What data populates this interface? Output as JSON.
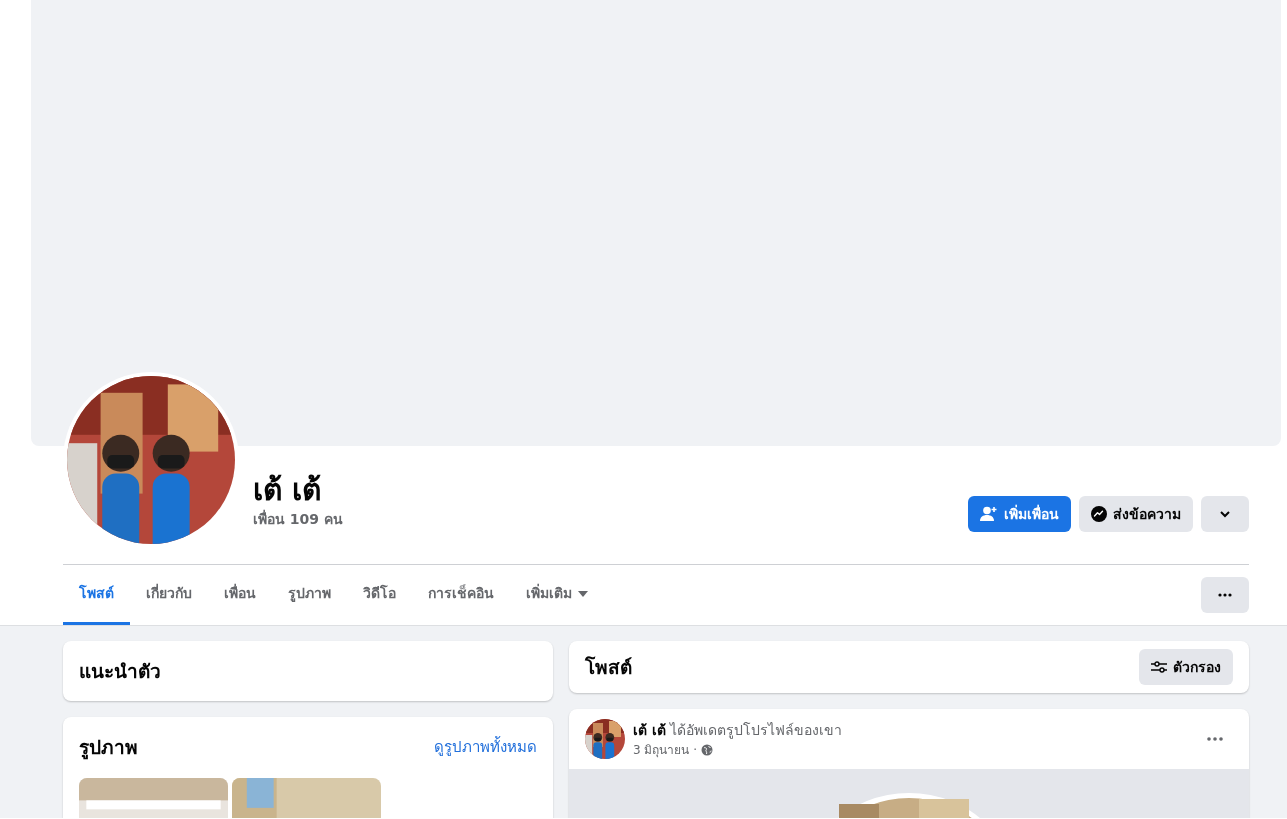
{
  "profile": {
    "name": "เต้ เต้",
    "friends": "เพื่อน 109 คน"
  },
  "actions": [
    {
      "label": "เพิ่มเพื่อน",
      "kind": "add-friend"
    },
    {
      "label": "ส่งข้อความ",
      "kind": "message"
    },
    {
      "kind": "more"
    }
  ],
  "tabs": [
    {
      "label": "โพสต์",
      "selected": true
    },
    {
      "label": "เกี่ยวกับ",
      "selected": false
    },
    {
      "label": "เพื่อน",
      "selected": false
    },
    {
      "label": "รูปภาพ",
      "selected": false
    },
    {
      "label": "วิดีโอ",
      "selected": false
    },
    {
      "label": "การเช็คอิน",
      "selected": false
    },
    {
      "label": "เพิ่มเติม",
      "selected": false,
      "dropdown": true
    }
  ],
  "intro": {
    "title": "แนะนำตัว"
  },
  "photos": {
    "title": "รูปภาพ",
    "link": "ดูรูปภาพทั้งหมด"
  },
  "posts_header": {
    "title": "โพสต์",
    "filter": "ตัวกรอง"
  },
  "post": {
    "author": "เต้ เต้",
    "action": "ได้อัพเดตรูปโปรไฟล์ของเขา",
    "date": "3 มิถุนายน ·"
  }
}
